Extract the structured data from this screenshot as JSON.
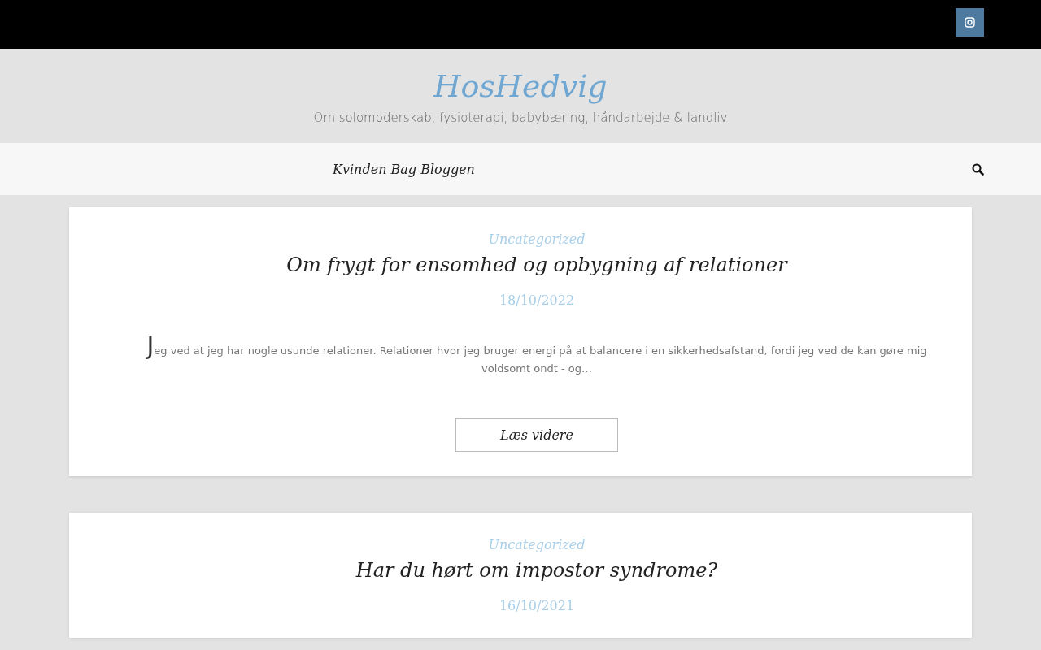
{
  "site": {
    "title": "HosHedvig",
    "tagline": "Om solomoderskab, fysioterapi, babybæring, håndarbejde & landliv"
  },
  "nav": {
    "items": [
      {
        "label": "Kvinden Bag Bloggen"
      }
    ]
  },
  "posts": [
    {
      "category": "Uncategorized",
      "title": "Om frygt for ensomhed og opbygning af relationer",
      "date": "18/10/2022",
      "excerpt": "Jeg ved at jeg har nogle usunde relationer. Relationer hvor jeg bruger energi på at balancere i en sikkerhedsafstand, fordi jeg ved de kan gøre mig voldsomt ondt - og…",
      "button": "Læs videre"
    },
    {
      "category": "Uncategorized",
      "title": "Har du hørt om impostor syndrome?",
      "date": "16/10/2021"
    }
  ]
}
